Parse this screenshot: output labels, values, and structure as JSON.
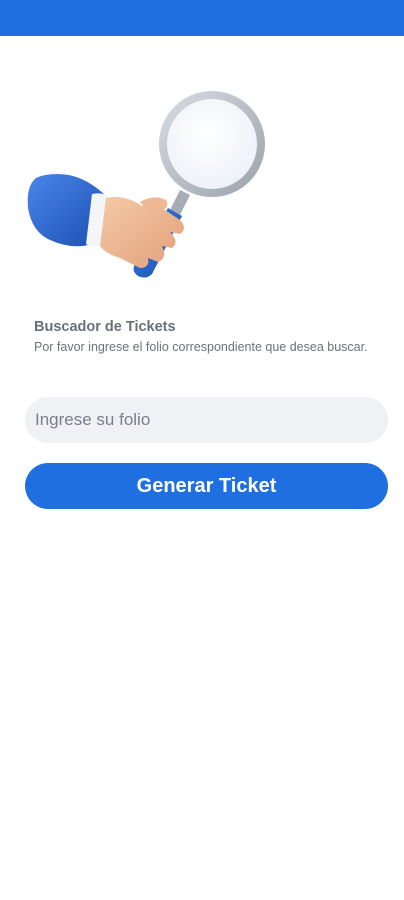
{
  "colors": {
    "primary": "#1f6fe0",
    "input_background": "#eff1f5",
    "text_muted": "#6b6f78"
  },
  "header": {
    "bar_color": "#1f6fe0"
  },
  "illustration": {
    "icon": "hand-holding-magnifying-glass-icon"
  },
  "search": {
    "title": "Buscador de Tickets",
    "description": "Por favor ingrese el folio correspondiente que desea buscar.",
    "placeholder": "Ingrese su folio",
    "value": "",
    "button_label": "Generar Ticket"
  }
}
